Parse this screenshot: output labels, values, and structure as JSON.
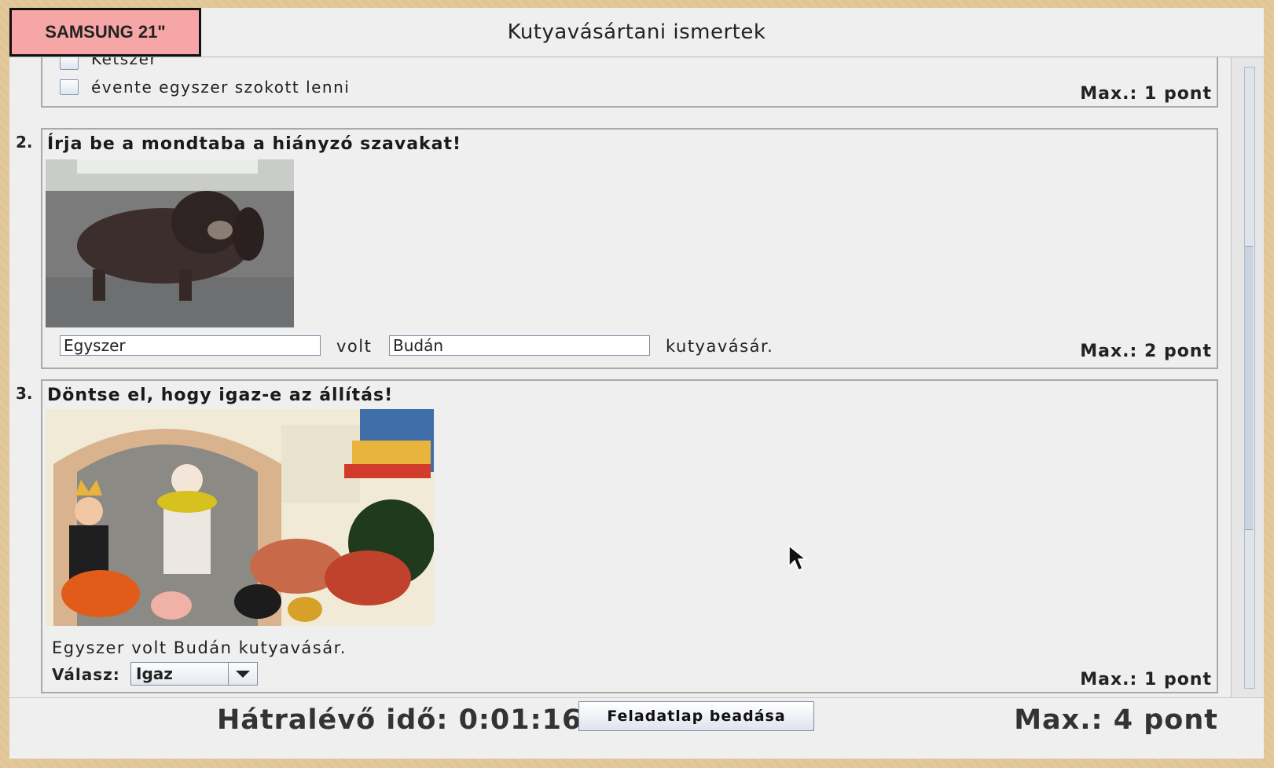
{
  "window": {
    "title": "Kutyavásártani ismertek"
  },
  "monitor_label": "SAMSUNG 21\"",
  "question1": {
    "options": [
      "Kétszer",
      "évente egyszer szokott lenni"
    ],
    "max": "Max.: 1 pont"
  },
  "question2": {
    "number": "2.",
    "prompt": "Írja be a mondtaba a hiányzó szavakat!",
    "image": "dog-photo",
    "field1_value": "Egyszer",
    "word1": "volt",
    "field2_value": "Budán",
    "word2": "kutyavásár.",
    "max": "Max.: 2 pont"
  },
  "question3": {
    "number": "3.",
    "prompt": "Döntse el, hogy igaz-e az állítás!",
    "image": "dog-market-illustration",
    "statement": "Egyszer volt Budán kutyavásár.",
    "answer_label": "Válasz:",
    "answer_value": "Igaz",
    "max": "Max.: 1 pont"
  },
  "footer": {
    "timer": "Hátralévő idő: 0:01:16",
    "submit_label": "Feladatlap beadása",
    "total_max": "Max.: 4 pont"
  },
  "colors": {
    "label_bg": "#f6a6a6",
    "window_bg": "#efefef",
    "border": "#a9a9a9"
  }
}
